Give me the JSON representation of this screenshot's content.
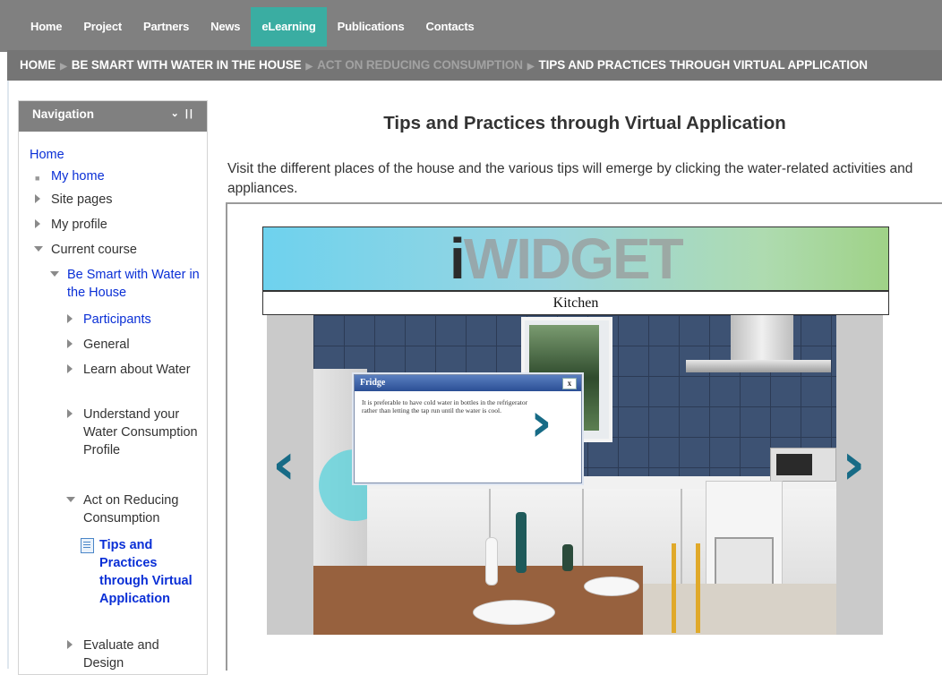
{
  "topnav": {
    "items": [
      "Home",
      "Project",
      "Partners",
      "News",
      "eLearning",
      "Publications",
      "Contacts"
    ],
    "active": "eLearning"
  },
  "breadcrumb": {
    "items": [
      "HOME",
      "BE SMART WITH WATER IN THE HOUSE",
      "ACT ON REDUCING CONSUMPTION",
      "TIPS AND PRACTICES THROUGH VIRTUAL APPLICATION"
    ]
  },
  "navigation": {
    "title": "Navigation",
    "controls": "⌄ ||",
    "home": "Home",
    "my_home": "My home",
    "site_pages": "Site pages",
    "my_profile": "My profile",
    "current_course": "Current course",
    "course": "Be Smart with Water in the House",
    "participants": "Participants",
    "general": "General",
    "learn_about_water": "Learn about Water",
    "understand": "Understand your Water Consumption Profile",
    "act_on_reducing": "Act on Reducing Consumption",
    "tips_and_practices": "Tips and Practices through Virtual Application",
    "evaluate": "Evaluate and Design"
  },
  "main": {
    "title": "Tips and Practices through Virtual Application",
    "intro": "Visit the different places of the house and the various tips will emerge by clicking the water-related activities and appliances."
  },
  "widget": {
    "logo_i": "i",
    "logo_rest": "WIDGET",
    "room": "Kitchen",
    "prev_arrow": "‹",
    "next_arrow": "›",
    "popup_title": "Fridge",
    "popup_close": "x",
    "popup_text": "It is preferable to have cold water in bottles in the refrigerator rather than letting the tap run until the water is cool.",
    "popup_next": "›"
  },
  "colors": {
    "nav_bg": "#808080",
    "active_tab": "#3aada2",
    "link": "#0a2fd6",
    "arrow": "#176b86"
  }
}
